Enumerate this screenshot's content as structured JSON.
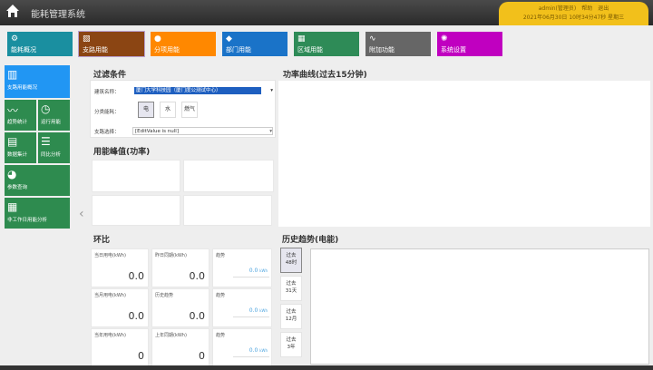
{
  "header": {
    "title": "能耗管理系统",
    "user": "admin(管理员)",
    "help": "帮助",
    "logout": "退出",
    "datetime": "2021年06月30日 10时34分47秒 星期三"
  },
  "nav": [
    {
      "label": "能耗概况",
      "color": "#1a8fa0",
      "icon": "gear-icon"
    },
    {
      "label": "支路用能",
      "color": "#8b4513",
      "icon": "chart-board-icon"
    },
    {
      "label": "分项用能",
      "color": "#ff8800",
      "icon": "person-icon"
    },
    {
      "label": "部门用能",
      "color": "#1a73c8",
      "icon": "cube-icon"
    },
    {
      "label": "区域用能",
      "color": "#2e8b57",
      "icon": "grid-icon"
    },
    {
      "label": "附加功能",
      "color": "#666666",
      "icon": "pulse-icon"
    },
    {
      "label": "系统设置",
      "color": "#c000c0",
      "icon": "settings-icon"
    }
  ],
  "sidebar": [
    {
      "label": "支路用能概况"
    },
    {
      "label": "趋势统计"
    },
    {
      "label": "运行用能"
    },
    {
      "label": "数据集计"
    },
    {
      "label": "同比分析"
    },
    {
      "label": "参数查询"
    },
    {
      "label": "非工作日用能分析"
    }
  ],
  "filter": {
    "title": "过滤条件",
    "building_label": "建筑名称：",
    "building_value": "厦门大学科技园（厦门度公测试中心）",
    "category_label": "分类能耗：",
    "categories": [
      "电",
      "水",
      "燃气"
    ],
    "branch_label": "支路选择：",
    "branch_value": "[EditValue is null]"
  },
  "peak": {
    "title": "用能峰值(功率)"
  },
  "power_curve": {
    "title": "功率曲线(过去15分钟)"
  },
  "ratio": {
    "title": "环比",
    "rows": [
      {
        "a_label": "当日用电(kWh)",
        "a_value": "0.0",
        "b_label": "昨日同期(kWh)",
        "b_value": "0.0",
        "trend_label": "趋势",
        "trend_value": "0.0",
        "trend_unit": "kWh"
      },
      {
        "a_label": "当月用电(kWh)",
        "a_value": "0.0",
        "b_label": "历史趋势",
        "b_value": "0.0",
        "trend_label": "趋势",
        "trend_value": "0.0",
        "trend_unit": "kWh"
      },
      {
        "a_label": "当年用电(kWh)",
        "a_value": "0",
        "b_label": "上年同期(kWh)",
        "b_value": "0",
        "trend_label": "趋势",
        "trend_value": "0.0",
        "trend_unit": "kWh"
      }
    ]
  },
  "history": {
    "title": "历史趋势(电能)",
    "buttons": [
      [
        "过去",
        "48时"
      ],
      [
        "过去",
        "31天"
      ],
      [
        "过去",
        "12月"
      ],
      [
        "过去",
        "3年"
      ]
    ]
  }
}
